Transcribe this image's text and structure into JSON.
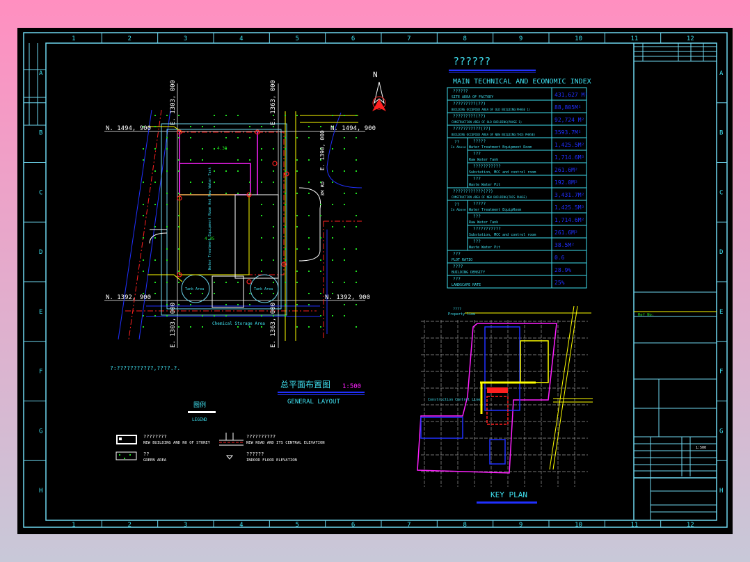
{
  "colors": {
    "cyan": "#3fe0f0",
    "frame": "#6fd8f0",
    "magenta": "#ff20ff",
    "blue": "#2030ff",
    "green": "#20e020",
    "yellow": "#ffff00",
    "red": "#ff2020"
  },
  "frame": {
    "columns": [
      "1",
      "2",
      "3",
      "4",
      "5",
      "6",
      "7",
      "8",
      "9",
      "10",
      "11",
      "12"
    ],
    "rows": [
      "A",
      "B",
      "C",
      "D",
      "E",
      "F",
      "G",
      "H"
    ]
  },
  "north_label": "N",
  "index": {
    "title_cn": "??????",
    "title_en": "MAIN TECHNICAL AND ECONOMIC INDEX",
    "rows": [
      {
        "cn": "??????",
        "en": "SITE AREA OF FACTORY",
        "value": "431,627 M²",
        "sub": false
      },
      {
        "cn": "?????????(??)",
        "en": "BUILDING OCCUPIED AREA OF OLD BUILDING(PHASE 1)",
        "value": "88,805M²",
        "sub": false
      },
      {
        "cn": "?????????(??)",
        "en": "CONSTRUCTION AREA OF OLD BUILDING(PHASE 1)",
        "value": "92,724 M²",
        "sub": false
      },
      {
        "cn": "???????????(??)",
        "en": "BUILDING OCCUPIED AREA OF NEW BUILDING(THIS PHASE)",
        "value": "3593.7M²",
        "sub": false
      },
      {
        "cn": "?????",
        "en": "Water Treatment Equipment Room",
        "value": "1,425.5M²",
        "sub": true,
        "group": "?? In Above"
      },
      {
        "cn": "???",
        "en": "Raw Water Tank",
        "value": "1,714.6M²",
        "sub": true
      },
      {
        "cn": "???????????",
        "en": "Substation, MCC and control room",
        "value": "261.6M²",
        "sub": true
      },
      {
        "cn": "???",
        "en": "Waste Water Pit",
        "value": "192.0M²",
        "sub": true
      },
      {
        "cn": "????????????(??)",
        "en": "CONSTRUCTION AREA OF NEW BUILDING(THIS PHASE)",
        "value": "3,431.7M²",
        "sub": false
      },
      {
        "cn": "?????",
        "en": "Water Treatment EquipRoom",
        "value": "1,425.5M²",
        "sub": true,
        "group": "?? In Above"
      },
      {
        "cn": "???",
        "en": "Raw Water Tank",
        "value": "1,714.6M²",
        "sub": true
      },
      {
        "cn": "???????????",
        "en": "Substation, MCC and control room",
        "value": "261.6M²",
        "sub": true
      },
      {
        "cn": "???",
        "en": "Waste Water Pit",
        "value": "38.5M²",
        "sub": true
      },
      {
        "cn": "???",
        "en": "PLOT RATIO",
        "value": "0.6",
        "sub": false
      },
      {
        "cn": "????",
        "en": "BUILDING DENSITY",
        "value": "28.9%",
        "sub": false
      },
      {
        "cn": "???",
        "en": "LANDSCAPE RATE",
        "value": "25%",
        "sub": false
      }
    ]
  },
  "site": {
    "grid": {
      "n_top": "N. 1494, 900",
      "n_bottom": "N. 1392, 900",
      "e_left": "E. 1303, 000",
      "e_right": "E. 1363, 000",
      "e_road": "E. 1390, 000"
    },
    "road_label": "3M RD",
    "chemical_area": "Chemical Storage Area",
    "tank_area": "Tank Area",
    "elev_main": "4.30",
    "elev_bldg": "4.45",
    "bldg_label": "Water Treatment Equipment Room And Raw Water Tank"
  },
  "note": "?:???????????,????.?.",
  "general_layout": {
    "title_cn": "总平面布置图",
    "scale": "1:500",
    "title_en": "GENERAL LAYOUT"
  },
  "legend": {
    "title": "图例",
    "subtitle": "LEGEND",
    "items": [
      {
        "cn": "????????",
        "en": "NEW BUILDING AND NO OF STOREY"
      },
      {
        "cn": "??",
        "en": "GREEN AREA"
      },
      {
        "cn": "??????????",
        "en": "NEW ROAD AND ITS CENTRAL ELEVATION"
      },
      {
        "cn": "??????",
        "en": "INDOOR FLOOR ELEVATION"
      }
    ]
  },
  "key_plan": {
    "title": "KEY PLAN",
    "property_line_cn": "????",
    "property_line": "Property line",
    "construction_line": "Construction Control Line"
  },
  "title_block": {
    "ref_label": "Ref No:",
    "scale": "1:500"
  }
}
